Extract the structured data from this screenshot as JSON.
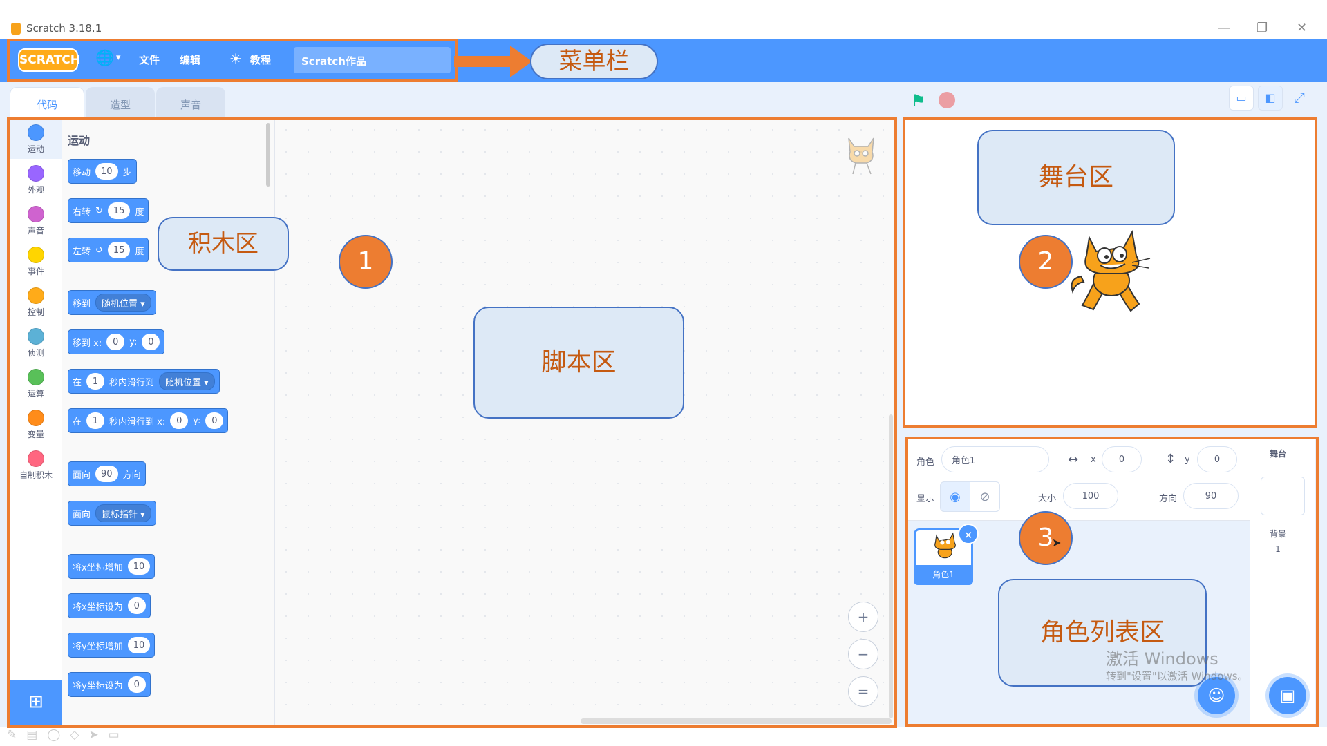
{
  "window": {
    "title": "Scratch 3.18.1",
    "minimize": "—",
    "restore": "❐",
    "close": "✕"
  },
  "menubar": {
    "logo": "SCRATCH",
    "globe_icon": "🌐",
    "globe_caret": "▾",
    "file": "文件",
    "edit": "编辑",
    "tutorial_icon": "☀",
    "tutorial": "教程",
    "project_title": "Scratch作品"
  },
  "annotations": {
    "menubar_label": "菜单栏",
    "blocks_label": "积木区",
    "script_label": "脚本区",
    "stage_label": "舞台区",
    "sprite_list_label": "角色列表区",
    "num1": "1",
    "num2": "2",
    "num3": "3"
  },
  "tabs": {
    "code": "代码",
    "costumes": "造型",
    "sounds": "声音"
  },
  "categories": [
    {
      "label": "运动",
      "color": "#4c97ff"
    },
    {
      "label": "外观",
      "color": "#9966ff"
    },
    {
      "label": "声音",
      "color": "#cf63cf"
    },
    {
      "label": "事件",
      "color": "#ffd500"
    },
    {
      "label": "控制",
      "color": "#ffab19"
    },
    {
      "label": "侦测",
      "color": "#5cb1d6"
    },
    {
      "label": "运算",
      "color": "#59c059"
    },
    {
      "label": "变量",
      "color": "#ff8c1a"
    },
    {
      "label": "自制积木",
      "color": "#ff6680"
    }
  ],
  "palette": {
    "section": "运动",
    "b1": {
      "a": "移动",
      "v": "10",
      "b": "步"
    },
    "b2": {
      "a": "右转",
      "icon": "↻",
      "v": "15",
      "b": "度"
    },
    "b3": {
      "a": "左转",
      "icon": "↺",
      "v": "15",
      "b": "度"
    },
    "b4": {
      "a": "移到",
      "d": "随机位置 ▾"
    },
    "b5": {
      "a": "移到 x:",
      "x": "0",
      "b": "y:",
      "y": "0"
    },
    "b6": {
      "a": "在",
      "v": "1",
      "b": "秒内滑行到",
      "d": "随机位置 ▾"
    },
    "b7": {
      "a": "在",
      "v": "1",
      "b": "秒内滑行到 x:",
      "x": "0",
      "c": "y:",
      "y": "0"
    },
    "b8": {
      "a": "面向",
      "v": "90",
      "b": "方向"
    },
    "b9": {
      "a": "面向",
      "d": "鼠标指针 ▾"
    },
    "b10": {
      "a": "将x坐标增加",
      "v": "10"
    },
    "b11": {
      "a": "将x坐标设为",
      "v": "0"
    },
    "b12": {
      "a": "将y坐标增加",
      "v": "10"
    },
    "b13": {
      "a": "将y坐标设为",
      "v": "0"
    }
  },
  "zoom": {
    "in": "+",
    "out": "−",
    "reset": "="
  },
  "sprite_info": {
    "sprite_label": "角色",
    "sprite_name": "角色1",
    "x_label": "x",
    "x": "0",
    "y_label": "y",
    "y": "0",
    "show_label": "显示",
    "size_label": "大小",
    "size": "100",
    "direction_label": "方向",
    "direction": "90"
  },
  "sprite_list": {
    "sprite1": "角色1"
  },
  "stage_col": {
    "title": "舞台",
    "backdrop_label": "背景",
    "backdrop_count": "1"
  },
  "watermark": {
    "line1": "激活 Windows",
    "line2": "转到\"设置\"以激活 Windows。"
  }
}
